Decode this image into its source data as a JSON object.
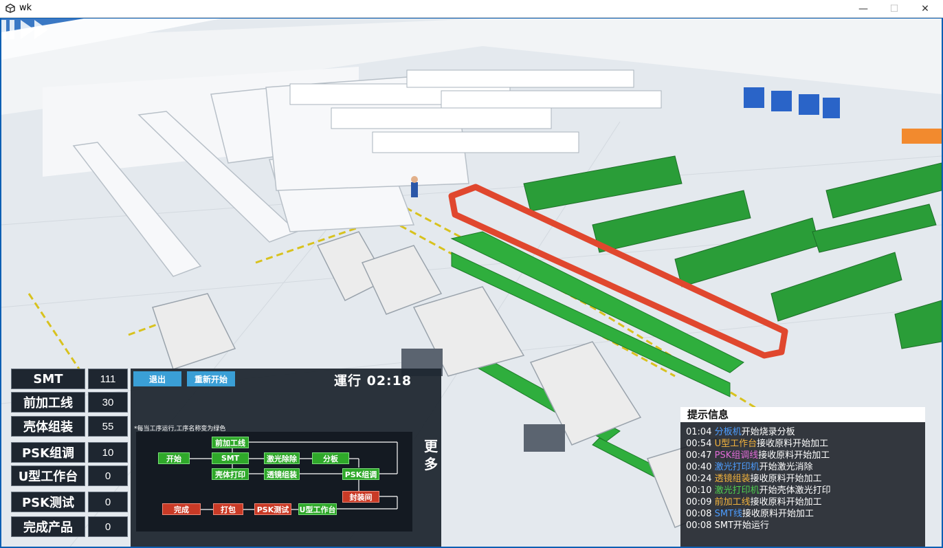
{
  "window": {
    "title": "wk",
    "minimize": "—",
    "maximize": "☐",
    "close": "✕"
  },
  "stats": [
    {
      "label": "SMT",
      "value": "111"
    },
    {
      "label": "前加工线",
      "value": "30"
    },
    {
      "label": "壳体组装",
      "value": "55"
    },
    {
      "label": "PSK组调",
      "value": "10"
    },
    {
      "label": "U型工作台",
      "value": "0"
    },
    {
      "label": "PSK测试",
      "value": "0"
    },
    {
      "label": "完成产品",
      "value": "0"
    }
  ],
  "process": {
    "exit_label": "退出",
    "restart_label": "重新开始",
    "runtime": "運行 02:18",
    "note": "*每当工序运行,工序名称变为绿色",
    "more": "更多",
    "nodes": {
      "start": "开始",
      "pre": "前加工线",
      "smt": "SMT",
      "shell_print": "壳体打印",
      "laser_remove": "激光除除",
      "lens_assembly": "透镜组装",
      "split": "分板",
      "psk_adjust": "PSK组调",
      "seal": "封装间",
      "done": "完成",
      "pack": "打包",
      "psk_test": "PSK测试",
      "u_bench": "U型工作台"
    }
  },
  "hints": {
    "title": "提示信息",
    "lines": [
      {
        "time": "01:04 ",
        "name": "分板机",
        "rest": "开始烧录分板",
        "color": "#4d9dff"
      },
      {
        "time": "00:54 ",
        "name": "U型工作台",
        "rest": "接收原料开始加工",
        "color": "#f2b33d"
      },
      {
        "time": "00:47 ",
        "name": "PSK组调线",
        "rest": "接收原料开始加工",
        "color": "#e06bd6"
      },
      {
        "time": "00:40 ",
        "name": "激光打印机",
        "rest": "开始激光消除",
        "color": "#4d9dff"
      },
      {
        "time": "00:24 ",
        "name": "透镜组装",
        "rest": "接收原料开始加工",
        "color": "#f2b33d"
      },
      {
        "time": "00:10 ",
        "name": "激光打印机",
        "rest": "开始壳体激光打印",
        "color": "#4fd14f"
      },
      {
        "time": "00:09 ",
        "name": "前加工线",
        "rest": "接收原料开始加工",
        "color": "#f2b33d"
      },
      {
        "time": "00:08 ",
        "name": "SMT线",
        "rest": "接收原料开始加工",
        "color": "#4d9dff"
      },
      {
        "time": "00:08 ",
        "name": "",
        "rest": "SMT开始运行",
        "color": "#ffffff"
      }
    ]
  }
}
